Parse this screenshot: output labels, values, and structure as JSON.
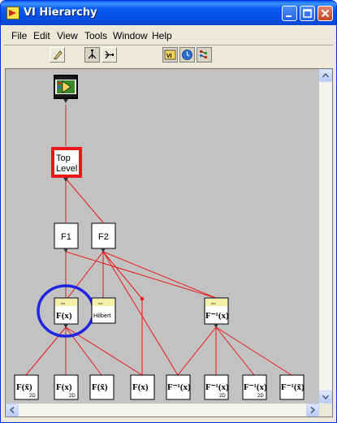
{
  "window": {
    "title": "VI Hierarchy"
  },
  "menu": [
    {
      "label": "File"
    },
    {
      "label": "Edit"
    },
    {
      "label": "View"
    },
    {
      "label": "Tools"
    },
    {
      "label": "Window"
    },
    {
      "label": "Help"
    }
  ],
  "toolbar": {
    "buttons": [
      {
        "icon": "redraw-icon"
      },
      {
        "icon": "horizontal-layout-icon"
      },
      {
        "icon": "vertical-layout-icon"
      },
      {
        "icon": "include-vi-lib-icon"
      },
      {
        "icon": "include-globals-icon"
      },
      {
        "icon": "include-typedefs-icon"
      }
    ]
  },
  "hierarchy": {
    "nodes": {
      "top": {
        "line1": "Top",
        "line2": "Level"
      },
      "f1": {
        "label": "F1"
      },
      "f2": {
        "label": "F2"
      },
      "fft": {
        "text": "F(x)",
        "badge": "⇔"
      },
      "hilbert": {
        "text": "Hilbert",
        "badge": "⇔"
      },
      "ifft": {
        "text": "F⁻¹(x)",
        "badge": "⇔"
      },
      "leaf1": {
        "text": "F(x̃)",
        "sub": "2D"
      },
      "leaf2": {
        "text": "F(x)",
        "sub": "2D"
      },
      "leaf3": {
        "text": "F(x̃)",
        "sub": ""
      },
      "leaf4": {
        "text": "F(x)",
        "sub": ""
      },
      "leaf5": {
        "text": "F⁻¹(x)",
        "sub": ""
      },
      "leaf6": {
        "text": "F⁻¹(x)",
        "sub": "2D"
      },
      "leaf7": {
        "text": "F⁻¹(x)",
        "sub": "2D"
      },
      "leaf8": {
        "text": "F⁻¹(x̃)",
        "sub": ""
      }
    },
    "colors": {
      "edge": "#e8181a",
      "highlight_box": "#e8181a",
      "highlight_circle": "#1f25e0",
      "canvas": "#c2c2c2",
      "badge": "#f5f0a8"
    }
  }
}
